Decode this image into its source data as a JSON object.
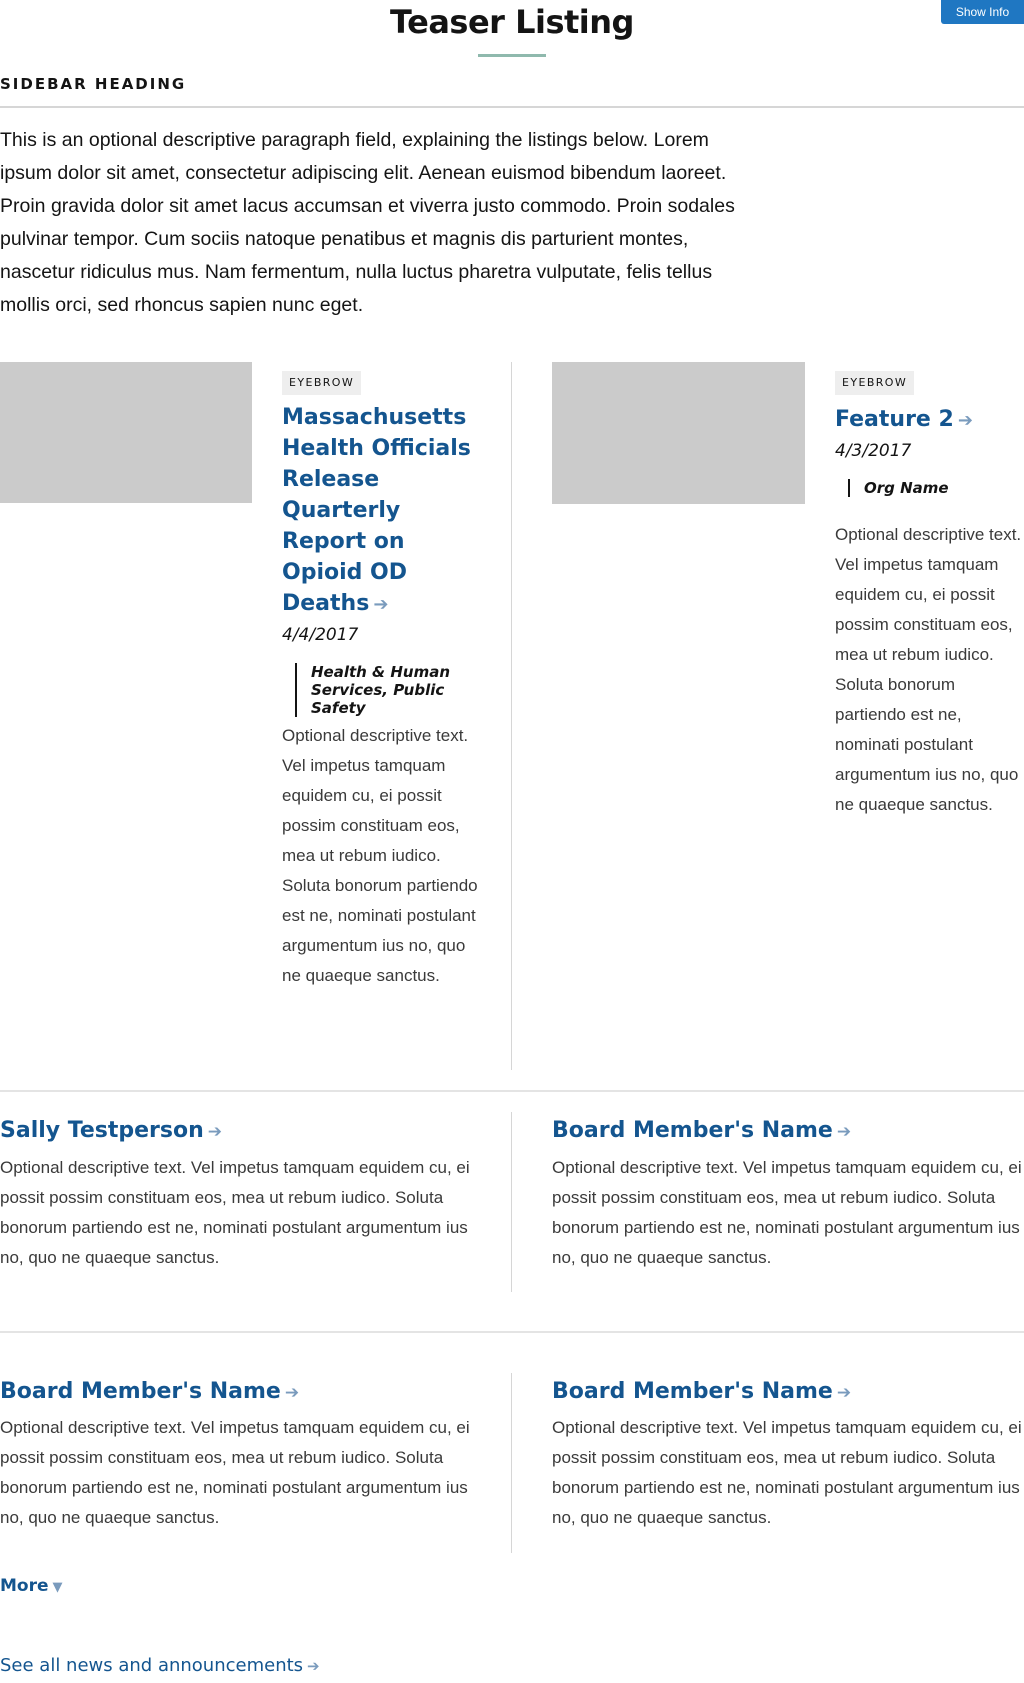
{
  "header": {
    "title": "Teaser Listing",
    "show_info_label": "Show Info"
  },
  "sidebar": {
    "heading": "SIDEBAR HEADING"
  },
  "intro": {
    "paragraph": "This is an optional descriptive paragraph field, explaining the listings below. Lorem ipsum dolor sit amet, consectetur adipiscing elit. Aenean euismod bibendum laoreet. Proin gravida dolor sit amet lacus accumsan et viverra justo commodo. Proin sodales pulvinar tempor. Cum sociis natoque penatibus et magnis dis parturient montes, nascetur ridiculus mus. Nam fermentum, nulla luctus pharetra vulputate, felis tellus mollis orci, sed rhoncus sapien nunc eget."
  },
  "features": [
    {
      "eyebrow": "EYEBROW",
      "title": "Massachusetts Health Officials Release Quarterly Report on Opioid OD Deaths",
      "date": "4/4/2017",
      "org": "Health & Human Services, Public Safety",
      "description": "Optional descriptive text. Vel impetus tamquam equidem cu, ei possit possim constituam eos, mea ut rebum iudico. Soluta bonorum partiendo est ne, nominati postulant argumentum ius no, quo ne quaeque sanctus."
    },
    {
      "eyebrow": "EYEBROW",
      "title": "Feature 2",
      "date": "4/3/2017",
      "org": "Org Name",
      "description": "Optional descriptive text. Vel impetus tamquam equidem cu, ei possit possim constituam eos, mea ut rebum iudico. Soluta bonorum partiendo est ne, nominati postulant argumentum ius no, quo ne quaeque sanctus."
    }
  ],
  "people": [
    {
      "name": "Sally Testperson",
      "description": "Optional descriptive text. Vel impetus tamquam equidem cu, ei possit possim constituam eos, mea ut rebum iudico. Soluta bonorum partiendo est ne, nominati postulant argumentum ius no, quo ne quaeque sanctus."
    },
    {
      "name": "Board Member's Name",
      "description": "Optional descriptive text. Vel impetus tamquam equidem cu, ei possit possim constituam eos, mea ut rebum iudico. Soluta bonorum partiendo est ne, nominati postulant argumentum ius no, quo ne quaeque sanctus."
    },
    {
      "name": "Board Member's Name",
      "description": "Optional descriptive text. Vel impetus tamquam equidem cu, ei possit possim constituam eos, mea ut rebum iudico. Soluta bonorum partiendo est ne, nominati postulant argumentum ius no, quo ne quaeque sanctus."
    },
    {
      "name": "Board Member's Name",
      "description": "Optional descriptive text. Vel impetus tamquam equidem cu, ei possit possim constituam eos, mea ut rebum iudico. Soluta bonorum partiendo est ne, nominati postulant argumentum ius no, quo ne quaeque sanctus."
    }
  ],
  "footer": {
    "more_label": "More",
    "see_all_label": "See all news and announcements"
  },
  "icons": {
    "arrow": "arrow-right-icon",
    "chevron": "chevron-down-icon"
  },
  "colors": {
    "link": "#14558f",
    "arrow": "#7a9bbd",
    "button": "#1f77c2",
    "title_rule": "#8fb9ad",
    "image_placeholder": "#cbcbcb"
  }
}
